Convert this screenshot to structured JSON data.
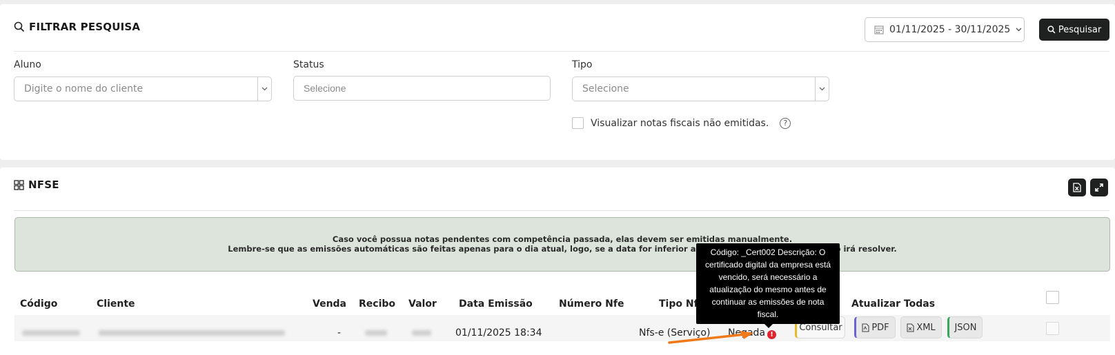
{
  "filter": {
    "title": "FILTRAR PESQUISA",
    "date_range": "01/11/2025 - 30/11/2025",
    "search_button": "Pesquisar",
    "aluno_label": "Aluno",
    "aluno_placeholder": "Digite o nome do cliente",
    "status_label": "Status",
    "status_placeholder": "Selecione",
    "tipo_label": "Tipo",
    "tipo_placeholder": "Selecione",
    "checkbox_label": "Visualizar notas fiscais não emitidas.",
    "help_glyph": "?"
  },
  "nfse": {
    "title": "NFSE",
    "alert_line1": "Caso você possua notas pendentes com competência passada, elas devem ser emitidas manualmente.",
    "alert_line2": "Lembre-se que as emissões automáticas são feitas apenas para o dia atual, logo, se a data for inferior a hoje, a emissão automática não irá resolver.",
    "columns": [
      "Código",
      "Cliente",
      "Venda",
      "Recibo",
      "Valor",
      "Data Emissão",
      "Número Nfe",
      "Tipo Nfe",
      "Atualizar Todas"
    ],
    "row": {
      "venda": "-",
      "data_emissao": "01/11/2025 18:34",
      "tipo_nfe": "Nfs-e (Serviço)",
      "status": "Negada",
      "error_glyph": "!",
      "consultar": "Consultar",
      "pdf": "PDF",
      "xml": "XML",
      "json": "JSON"
    },
    "tooltip": "Código: _Cert002 Descrição: O certificado digital da empresa está vencido, será necessário a atualização do mesmo antes de continuar as emissões de nota fiscal."
  },
  "colors": {
    "dark_button": "#1e211f",
    "alert_bg": "#dde4dc",
    "error_red": "#e0242e",
    "annotation_arrow": "#f07a1a"
  },
  "icons": [
    "search-icon",
    "calendar-icon",
    "chevron-down-icon",
    "grid-icon",
    "excel-icon",
    "expand-icon",
    "pdf-icon",
    "xml-icon",
    "help-icon",
    "error-icon"
  ]
}
